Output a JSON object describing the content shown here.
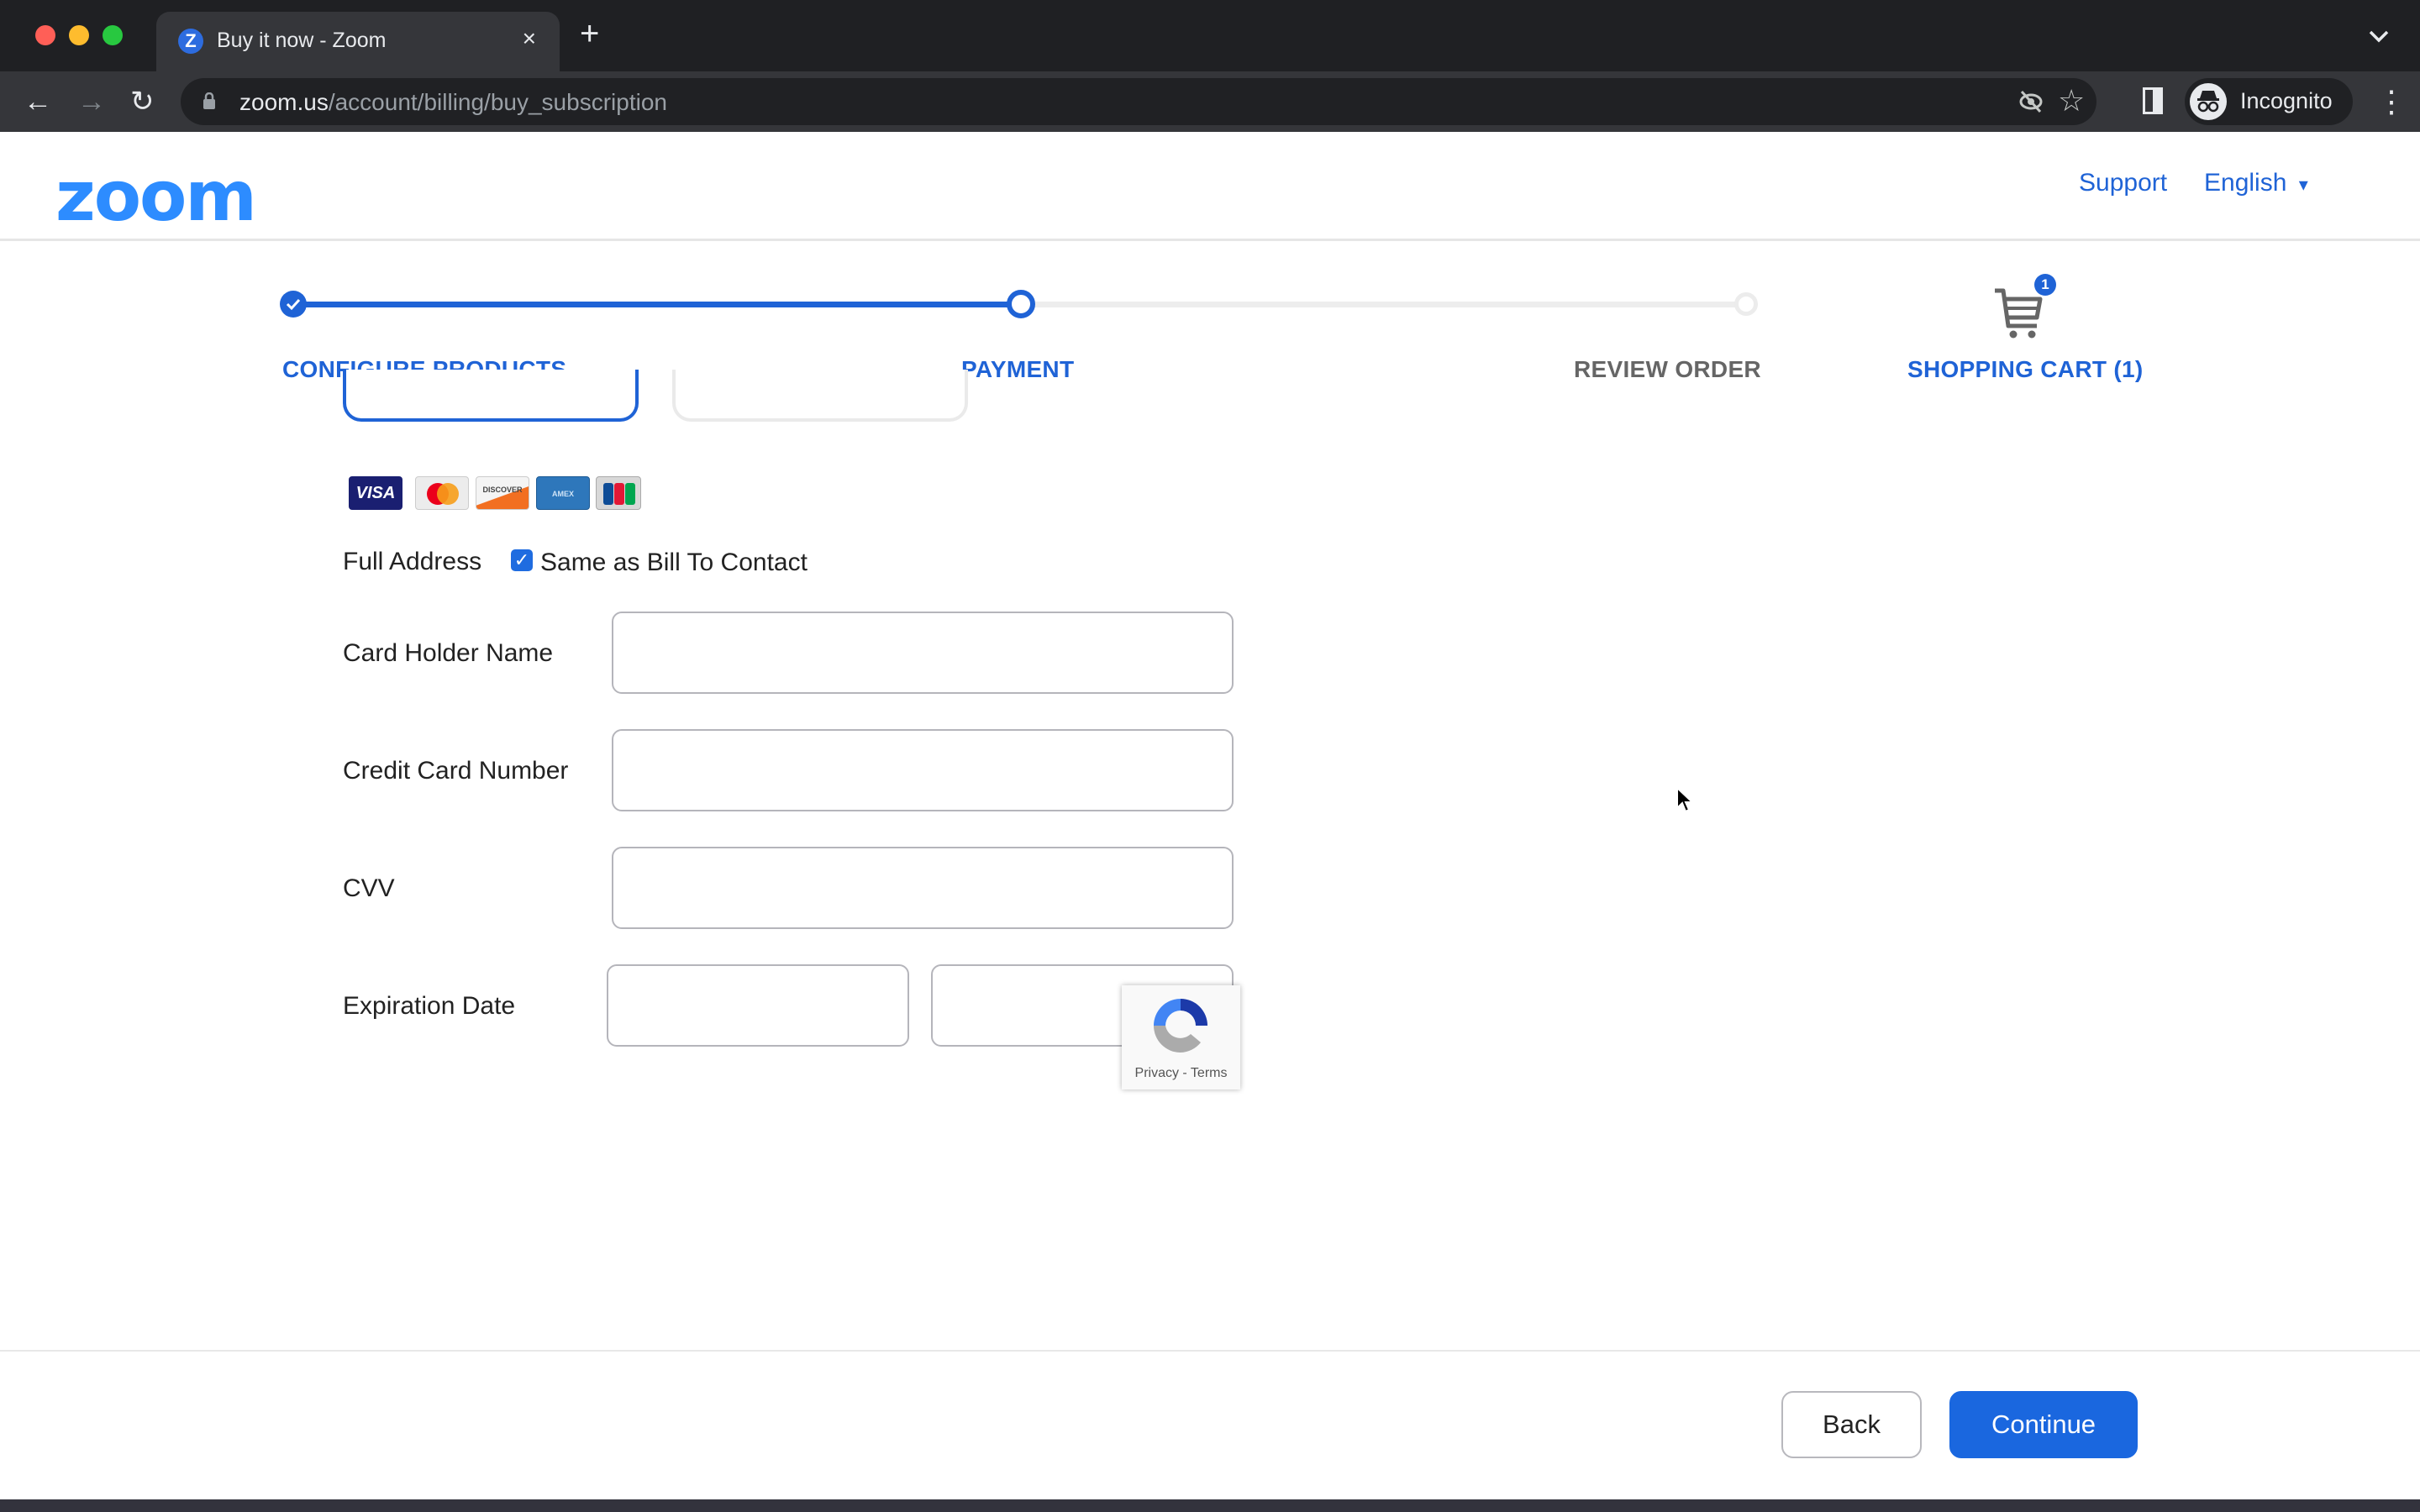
{
  "browser": {
    "tab_title": "Buy it now - Zoom",
    "tab_favicon_letter": "Z",
    "url_host": "zoom.us",
    "url_path": "/account/billing/buy_subscription",
    "profile_label": "Incognito",
    "icons": {
      "close": "×",
      "new_tab": "+",
      "tab_list": "⌄",
      "back": "←",
      "forward": "→",
      "reload": "↻",
      "star": "☆",
      "menu": "⋮"
    }
  },
  "header": {
    "logo": "zoom",
    "links": [
      "Support",
      "English"
    ],
    "language_caret": "▾"
  },
  "stepper": {
    "steps": [
      {
        "label": "CONFIGURE PRODUCTS",
        "state": "complete"
      },
      {
        "label": "PAYMENT",
        "state": "current"
      },
      {
        "label": "REVIEW ORDER",
        "state": "upcoming"
      }
    ],
    "cart_label": "SHOPPING CART (1)",
    "cart_count": "1"
  },
  "payment": {
    "card_brands": [
      "VISA",
      "MC",
      "DISCOVER",
      "AMEX",
      "JCB"
    ],
    "full_address_label": "Full Address",
    "same_as_bill_label": "Same as Bill To Contact",
    "same_as_bill_checked": true,
    "fields": [
      {
        "label": "Card Holder Name",
        "value": ""
      },
      {
        "label": "Credit Card Number",
        "value": ""
      },
      {
        "label": "CVV",
        "value": ""
      }
    ],
    "expiration_label": "Expiration Date",
    "expiration_month": "",
    "expiration_year": "",
    "recaptcha_text": "Privacy - Terms"
  },
  "footer": {
    "back_label": "Back",
    "continue_label": "Continue"
  },
  "colors": {
    "accent": "#1f63d6",
    "logo": "#2d8cff",
    "continue_bg": "#1a67df"
  }
}
